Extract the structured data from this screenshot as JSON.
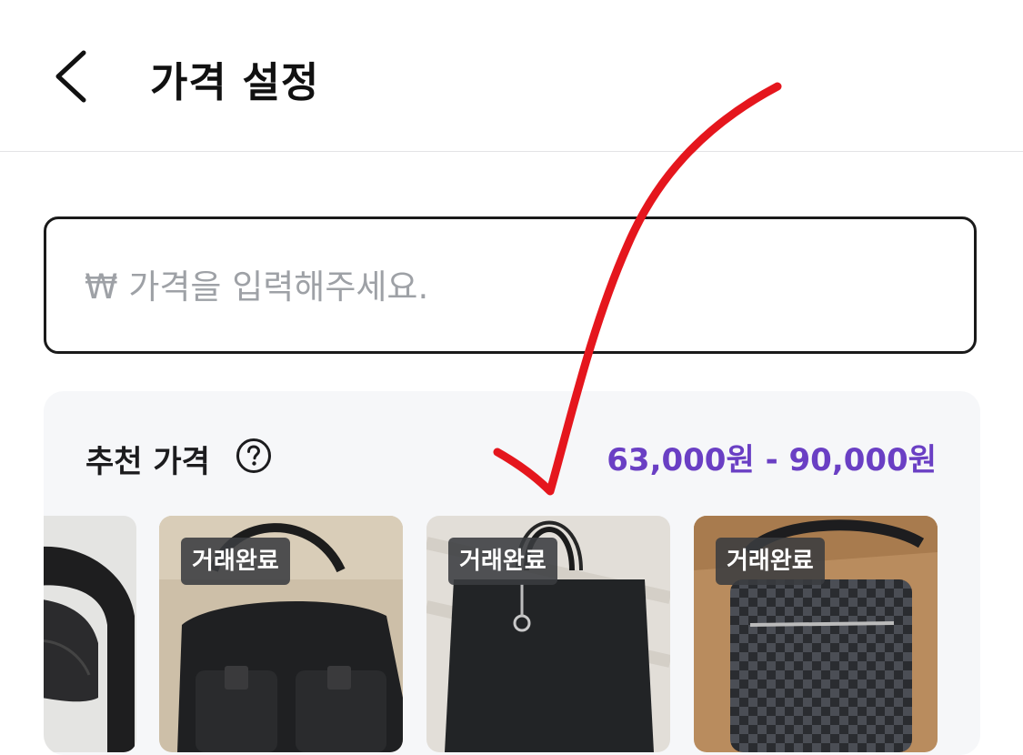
{
  "header": {
    "title": "가격 설정",
    "back_icon": "chevron-left-icon"
  },
  "price_input": {
    "placeholder": "₩ 가격을 입력해주세요.",
    "value": ""
  },
  "recommended": {
    "title": "추천 가격",
    "help_icon": "question-circle-icon",
    "range": "63,000원 - 90,000원",
    "accent_color": "#6a3fc4",
    "items": [
      {
        "image": "black-leather-belt",
        "badge": ""
      },
      {
        "image": "black-nylon-messenger-bag",
        "badge": "거래완료"
      },
      {
        "image": "black-leather-tote-bag",
        "badge": "거래완료"
      },
      {
        "image": "checkered-crossbody-bag",
        "badge": "거래완료"
      }
    ]
  },
  "annotation": {
    "type": "red-checkmark",
    "color": "#e5161d"
  }
}
